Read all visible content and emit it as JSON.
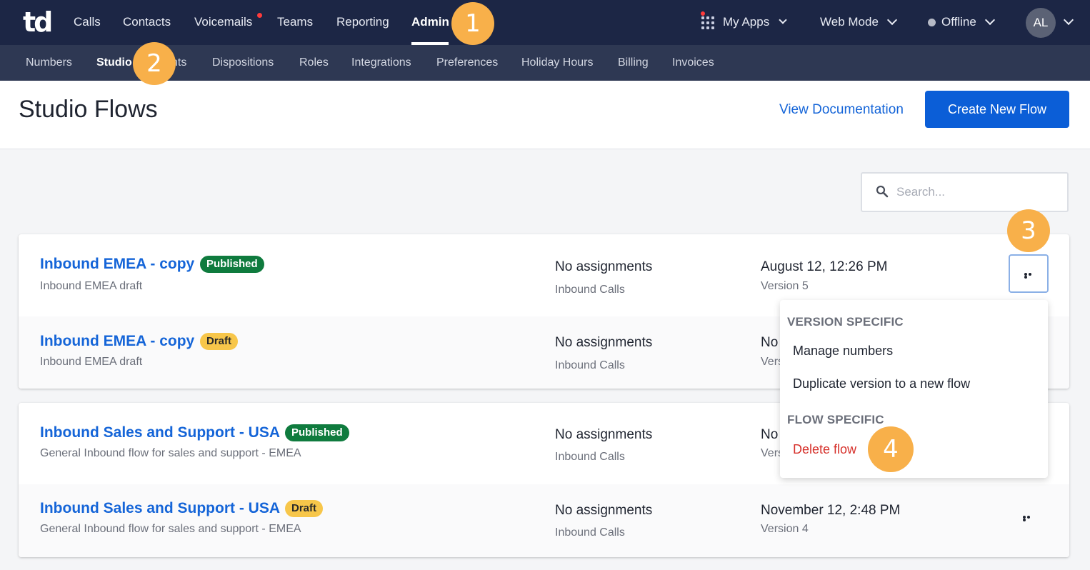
{
  "topnav": {
    "logo": "td",
    "items": [
      "Calls",
      "Contacts",
      "Voicemails",
      "Teams",
      "Reporting",
      "Admin"
    ],
    "active": "Admin",
    "my_apps": "My Apps",
    "web_mode": "Web Mode",
    "status": "Offline",
    "avatar_initials": "AL"
  },
  "subnav": {
    "items": [
      "Numbers",
      "Studio",
      "nts",
      "Dispositions",
      "Roles",
      "Integrations",
      "Preferences",
      "Holiday Hours",
      "Billing",
      "Invoices"
    ],
    "active": "Studio"
  },
  "header": {
    "title": "Studio Flows",
    "view_doc": "View Documentation",
    "create_button": "Create New Flow"
  },
  "search": {
    "placeholder": "Search..."
  },
  "flows": [
    {
      "name": "Inbound EMEA - copy",
      "badge": "Published",
      "desc": "Inbound EMEA draft",
      "assign": "No assignments",
      "calls": "Inbound Calls",
      "date": "August 12, 12:26 PM",
      "version": "Version 5"
    },
    {
      "name": "Inbound EMEA - copy",
      "badge": "Draft",
      "desc": "Inbound EMEA draft",
      "assign": "No assignments",
      "calls": "Inbound Calls",
      "date": "No",
      "version": "Vers"
    },
    {
      "name": "Inbound Sales and Support - USA",
      "badge": "Published",
      "desc": "General Inbound flow for sales and support - EMEA",
      "assign": "No assignments",
      "calls": "Inbound Calls",
      "date": "No",
      "version": "Vers"
    },
    {
      "name": "Inbound Sales and Support - USA",
      "badge": "Draft",
      "desc": "General Inbound flow for sales and support - EMEA",
      "assign": "No assignments",
      "calls": "Inbound Calls",
      "date": "November 12, 2:48 PM",
      "version": "Version 4"
    }
  ],
  "menu": {
    "version_heading": "VERSION SPECIFIC",
    "manage_numbers": "Manage numbers",
    "duplicate": "Duplicate version to a new flow",
    "flow_heading": "FLOW SPECIFIC",
    "delete": "Delete flow"
  },
  "steps": [
    "1",
    "2",
    "3",
    "4"
  ],
  "colors": {
    "nav_bg": "#1c2645",
    "subnav_bg": "#2e3853",
    "accent": "#0b5ed7",
    "link": "#1565d8",
    "published": "#0f7b3e",
    "draft": "#f7c64a",
    "danger": "#d6312b",
    "step": "#f8b04a"
  }
}
